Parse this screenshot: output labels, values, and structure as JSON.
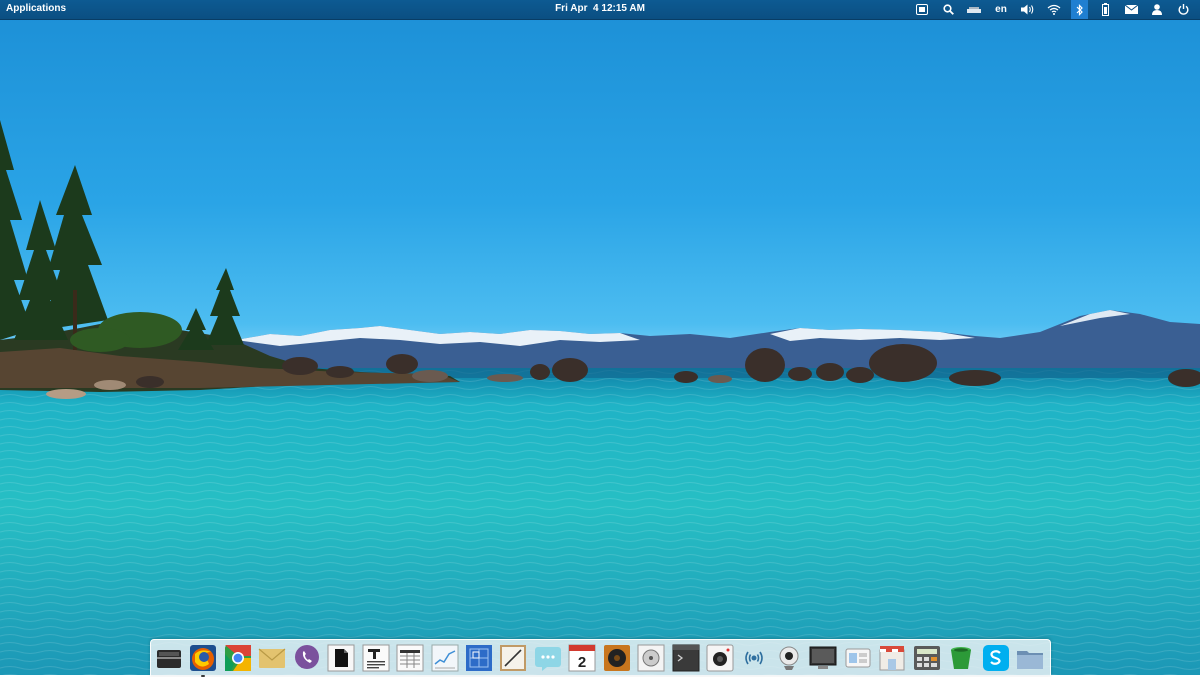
{
  "panel": {
    "applications_label": "Applications",
    "clock": "Fri Apr  4 12:15 AM",
    "indicators": [
      {
        "icon": "keyboard-icon"
      },
      {
        "icon": "search-icon"
      },
      {
        "icon": "storage-device-icon"
      },
      {
        "icon": "language-indicator",
        "text": "en"
      },
      {
        "icon": "volume-icon"
      },
      {
        "icon": "wifi-icon"
      },
      {
        "icon": "bluetooth-icon",
        "active": true
      },
      {
        "icon": "battery-icon"
      },
      {
        "icon": "mail-icon"
      },
      {
        "icon": "user-icon"
      },
      {
        "icon": "power-icon"
      }
    ],
    "colors": {
      "panel_bg": "#0b4f82",
      "active_indicator": "#1f7fd1",
      "text": "#ffffff"
    }
  },
  "desktop": {
    "wallpaper": "lake-with-rocks-and-mountains"
  },
  "dock": {
    "items": [
      {
        "icon": "scanner-icon"
      },
      {
        "icon": "firefox-icon",
        "running": true
      },
      {
        "icon": "chrome-icon"
      },
      {
        "icon": "mail-envelope-icon"
      },
      {
        "icon": "viber-icon"
      },
      {
        "icon": "document-viewer-icon"
      },
      {
        "icon": "text-editor-icon"
      },
      {
        "icon": "spreadsheet-icon"
      },
      {
        "icon": "system-monitor-icon"
      },
      {
        "icon": "blueprint-icon"
      },
      {
        "icon": "drawing-icon"
      },
      {
        "icon": "messaging-icon"
      },
      {
        "icon": "calendar-icon",
        "text": "2"
      },
      {
        "icon": "music-player-icon"
      },
      {
        "icon": "disk-utility-icon"
      },
      {
        "icon": "terminal-icon"
      },
      {
        "icon": "camera-icon"
      },
      {
        "icon": "wireless-hotspot-icon"
      },
      {
        "icon": "webcam-icon"
      },
      {
        "icon": "monitor-icon"
      },
      {
        "icon": "settings-toggles-icon"
      },
      {
        "icon": "app-store-icon"
      },
      {
        "icon": "calculator-icon"
      },
      {
        "icon": "green-bucket-icon"
      },
      {
        "icon": "skype-icon"
      },
      {
        "icon": "file-manager-icon"
      }
    ]
  }
}
